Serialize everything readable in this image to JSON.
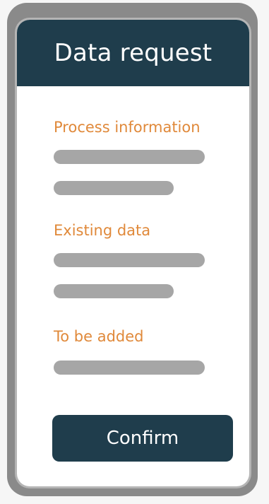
{
  "header": {
    "title": "Data request"
  },
  "sections": [
    {
      "label": "Process information"
    },
    {
      "label": "Existing data"
    },
    {
      "label": "To be added"
    }
  ],
  "actions": {
    "confirm_label": "Confirm"
  },
  "colors": {
    "header_bg": "#1f3d4c",
    "accent_orange": "#e0893a",
    "placeholder_gray": "#a6a6a6",
    "frame_gray": "#8a8a8a"
  }
}
